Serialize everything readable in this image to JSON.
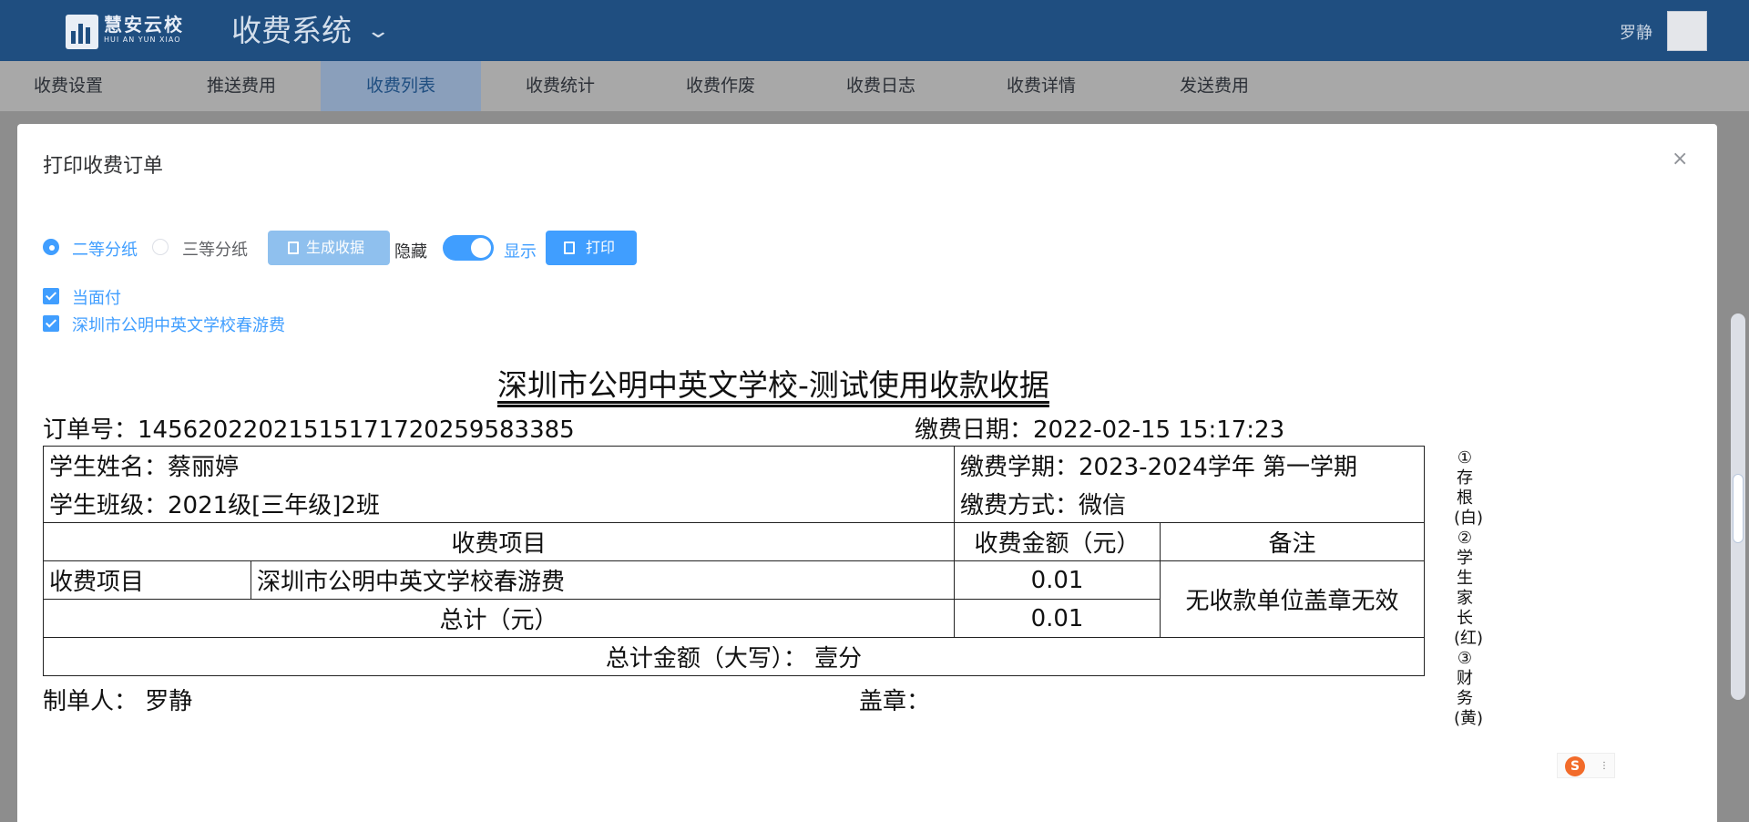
{
  "header": {
    "logo_cn": "慧安云校",
    "logo_en": "HUI AN YUN XIAO",
    "system_title": "收费系统",
    "user_name": "罗静"
  },
  "nav": {
    "items": [
      {
        "label": "收费设置"
      },
      {
        "label": "推送费用"
      },
      {
        "label": "收费列表",
        "active": true
      },
      {
        "label": "收费统计"
      },
      {
        "label": "收费作废"
      },
      {
        "label": "收费日志"
      },
      {
        "label": "收费详情"
      },
      {
        "label": "发送费用"
      }
    ]
  },
  "dialog": {
    "title": "打印收费订单",
    "close": "×",
    "options": {
      "paper_two": "二等分纸",
      "paper_three": "三等分纸",
      "generate_btn": "生成收据",
      "hide_label": "隐藏",
      "show_label": "显示",
      "print_btn": "打印",
      "check_pay": "当面付",
      "check_fee": "深圳市公明中英文学校春游费"
    }
  },
  "receipt": {
    "title": "深圳市公明中英文学校-测试使用收款收据",
    "order_no": "订单号：145620220215151717 20259583385",
    "order_no_clean": "订单号：14562022021515171720259583385",
    "pay_date": "缴费日期：2022-02-15 15:17:23",
    "student_name": "学生姓名：蔡丽婷",
    "student_class": "学生班级：2021级[三年级]2班",
    "term": "缴费学期：2023-2024学年 第一学期",
    "pay_method": "缴费方式：微信",
    "col_item": "收费项目",
    "col_amount": "收费金额（元）",
    "col_note": "备注",
    "row_label": "收费项目",
    "row_item": "深圳市公明中英文学校春游费",
    "row_amount": "0.01",
    "note_text": "无收款单位盖章无效",
    "total_label": "总计（元）",
    "total_amount": "0.01",
    "total_upper": "总计金额（大写）：  壹分",
    "maker": "制单人：  罗静",
    "stamp": "盖章：",
    "copies_note": "①存根(白)②学生家长(红)③财务(黄)"
  },
  "colors": {
    "header_bg": "#1f4e80",
    "primary": "#409eff"
  }
}
